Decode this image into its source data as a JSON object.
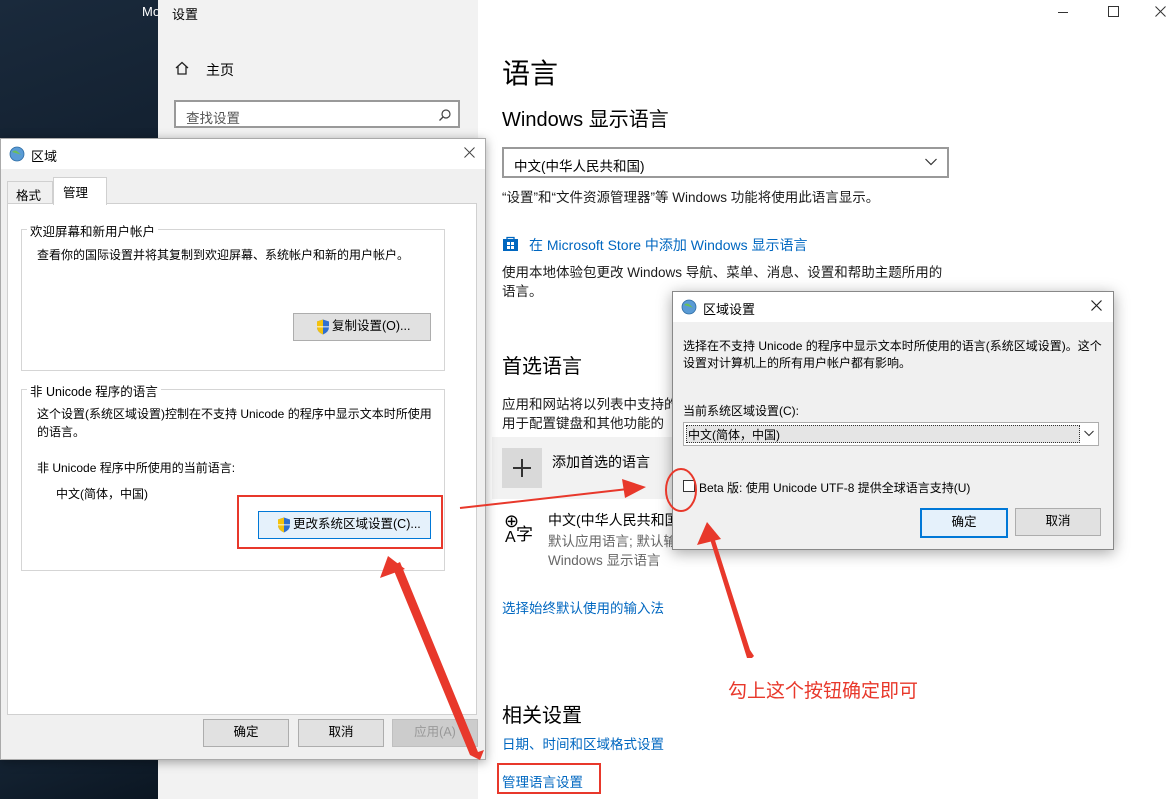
{
  "desktop": {
    "partial_text": "Mo"
  },
  "settings": {
    "window_title": "设置",
    "nav_home": "主页",
    "search_placeholder": "查找设置",
    "behind_text": "",
    "page_title": "语言",
    "display_language_heading": "Windows 显示语言",
    "display_language_value": "中文(中华人民共和国)",
    "display_language_note": "“设置”和“文件资源管理器”等 Windows 功能将使用此语言显示。",
    "store_link": "在 Microsoft Store 中添加 Windows 显示语言",
    "local_exp_text": "使用本地体验包更改 Windows 导航、菜单、消息、设置和帮助主题所用的语言。",
    "preferred_heading": "首选语言",
    "preferred_text_1": "应用和网站将以列表中支持的",
    "preferred_text_2": "用于配置键盘和其他功能的",
    "add_language_label": "添加首选的语言",
    "lang_item_name": "中文(中华人民共和国)",
    "lang_item_sub1": "默认应用语言; 默认输",
    "lang_item_sub2": "Windows 显示语言",
    "input_method_link": "选择始终默认使用的输入法",
    "related_heading": "相关设置",
    "related_link_1": "日期、时间和区域格式设置",
    "related_link_2": "管理语言设置"
  },
  "region_dialog": {
    "title": "区域",
    "tabs": [
      "格式",
      "管理"
    ],
    "group1_title": "欢迎屏幕和新用户帐户",
    "group1_text": "查看你的国际设置并将其复制到欢迎屏幕、系统帐户和新的用户帐户。",
    "copy_button": "复制设置(O)...",
    "group2_title": "非 Unicode 程序的语言",
    "group2_text": "这个设置(系统区域设置)控制在不支持 Unicode 的程序中显示文本时所使用的语言。",
    "current_label": "非 Unicode 程序中所使用的当前语言:",
    "current_value": "中文(简体，中国)",
    "change_button": "更改系统区域设置(C)...",
    "ok": "确定",
    "cancel": "取消",
    "apply": "应用(A)"
  },
  "region_settings_dialog": {
    "title": "区域设置",
    "description": "选择在不支持 Unicode 的程序中显示文本时所使用的语言(系统区域设置)。这个设置对计算机上的所有用户帐户都有影响。",
    "current_label": "当前系统区域设置(C):",
    "current_value": "中文(简体，中国)",
    "beta_label": "Beta 版: 使用 Unicode UTF-8 提供全球语言支持(U)",
    "beta_checked": false,
    "ok": "确定",
    "cancel": "取消"
  },
  "annotation": {
    "text": "勾上这个按钮确定即可",
    "color": "#e8382b"
  }
}
